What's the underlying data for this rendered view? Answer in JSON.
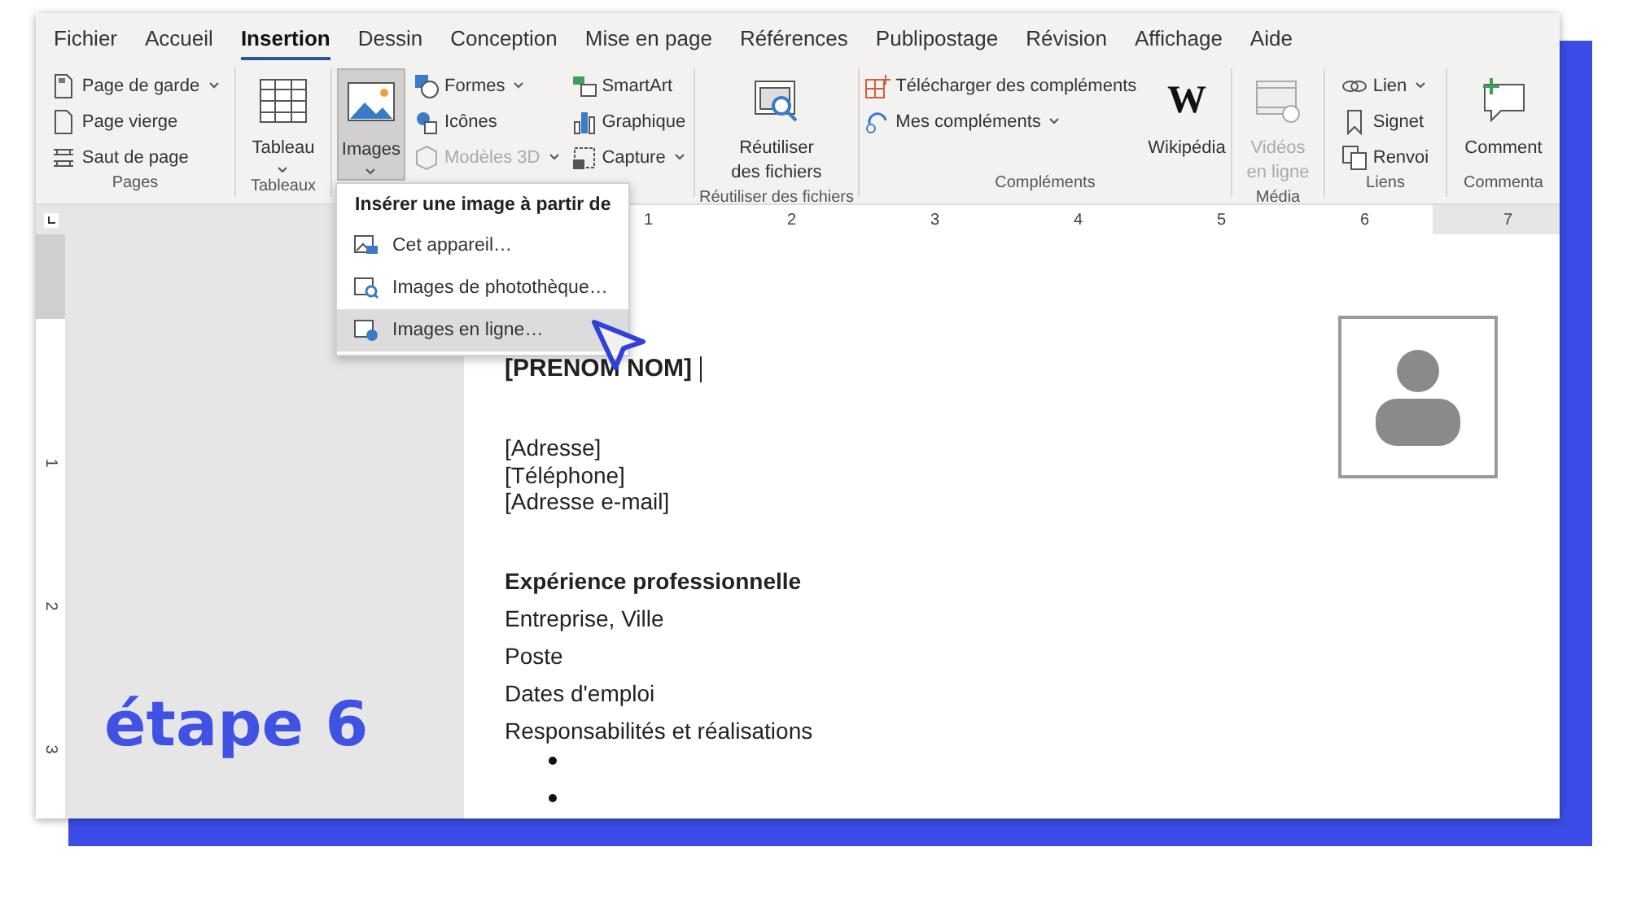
{
  "tabs": [
    {
      "label": "Fichier",
      "selected": false
    },
    {
      "label": "Accueil",
      "selected": false
    },
    {
      "label": "Insertion",
      "selected": true
    },
    {
      "label": "Dessin",
      "selected": false
    },
    {
      "label": "Conception",
      "selected": false
    },
    {
      "label": "Mise en page",
      "selected": false
    },
    {
      "label": "Références",
      "selected": false
    },
    {
      "label": "Publipostage",
      "selected": false
    },
    {
      "label": "Révision",
      "selected": false
    },
    {
      "label": "Affichage",
      "selected": false
    },
    {
      "label": "Aide",
      "selected": false
    }
  ],
  "ribbon": {
    "groups": [
      {
        "label": "Pages",
        "controls": [
          {
            "kind": "small",
            "label": "Page de garde",
            "dropdown": true,
            "disabled": false,
            "pressed": false
          },
          {
            "kind": "small",
            "label": "Page vierge",
            "dropdown": false,
            "disabled": false,
            "pressed": false
          },
          {
            "kind": "small",
            "label": "Saut de page",
            "dropdown": false,
            "disabled": false,
            "pressed": false
          }
        ]
      },
      {
        "label": "Tableaux",
        "controls": [
          {
            "kind": "big",
            "label": "Tableau",
            "dropdown": true,
            "disabled": false,
            "pressed": false
          }
        ]
      },
      {
        "controls": [
          {
            "kind": "big",
            "label": "Images",
            "dropdown": true,
            "disabled": false,
            "pressed": true
          },
          {
            "kind": "small",
            "label": "Formes",
            "dropdown": true,
            "disabled": false,
            "pressed": false
          },
          {
            "kind": "small",
            "label": "Icônes",
            "dropdown": false,
            "disabled": false,
            "pressed": false
          },
          {
            "kind": "small",
            "label": "Modèles 3D",
            "dropdown": true,
            "disabled": true,
            "pressed": false
          },
          {
            "kind": "small",
            "label": "SmartArt",
            "dropdown": false,
            "disabled": false,
            "pressed": false
          },
          {
            "kind": "small",
            "label": "Graphique",
            "dropdown": false,
            "disabled": false,
            "pressed": false
          },
          {
            "kind": "small",
            "label": "Capture",
            "dropdown": true,
            "disabled": false,
            "pressed": false
          }
        ]
      },
      {
        "label": "Réutiliser des fichiers",
        "controls": [
          {
            "kind": "big",
            "label": "Réutiliser des fichiers",
            "dropdown": false,
            "disabled": false,
            "pressed": false
          }
        ]
      },
      {
        "label": "Compléments",
        "controls": [
          {
            "kind": "small",
            "label": "Télécharger des compléments",
            "dropdown": false,
            "disabled": false,
            "pressed": false
          },
          {
            "kind": "small",
            "label": "Mes compléments",
            "dropdown": true,
            "disabled": false,
            "pressed": false
          },
          {
            "kind": "big",
            "label": "Wikipédia",
            "glyph": "W",
            "dropdown": false,
            "disabled": false,
            "pressed": false
          }
        ]
      },
      {
        "label": "Média",
        "controls": [
          {
            "kind": "big",
            "label": "Vidéos en ligne",
            "dropdown": false,
            "disabled": true,
            "pressed": false
          }
        ]
      },
      {
        "label": "Liens",
        "controls": [
          {
            "kind": "small",
            "label": "Lien",
            "dropdown": true,
            "disabled": false,
            "pressed": false
          },
          {
            "kind": "small",
            "label": "Signet",
            "dropdown": false,
            "disabled": false,
            "pressed": false
          },
          {
            "kind": "small",
            "label": "Renvoi",
            "dropdown": false,
            "disabled": false,
            "pressed": false
          }
        ]
      },
      {
        "label": "Commenta",
        "controls": [
          {
            "kind": "big",
            "label": "Comment",
            "dropdown": false,
            "disabled": false,
            "pressed": false
          }
        ]
      }
    ]
  },
  "menu": {
    "title": "Insérer une image à partir de",
    "items": [
      {
        "label": "Cet appareil…",
        "selected": false
      },
      {
        "label": "Images de photothèque…",
        "selected": false
      },
      {
        "label": "Images en ligne…",
        "selected": true
      }
    ]
  },
  "ruler": {
    "numbers": [
      "1",
      "2",
      "3",
      "4",
      "5",
      "6",
      "7"
    ]
  },
  "vertical_ruler": {
    "numbers": [
      "1",
      "2",
      "3"
    ]
  },
  "step_label": "étape 6",
  "document": {
    "name": "[PRENOM NOM]",
    "contact": [
      "[Adresse]",
      "[Téléphone]",
      "[Adresse e-mail]"
    ],
    "heading": "Expérience professionnelle",
    "lines": [
      "Entreprise, Ville",
      "Poste",
      "Dates d'emploi",
      "Responsabilités et réalisations"
    ],
    "bullets": [
      {
        "kind": "bullet"
      },
      {
        "kind": "bullet"
      }
    ]
  }
}
